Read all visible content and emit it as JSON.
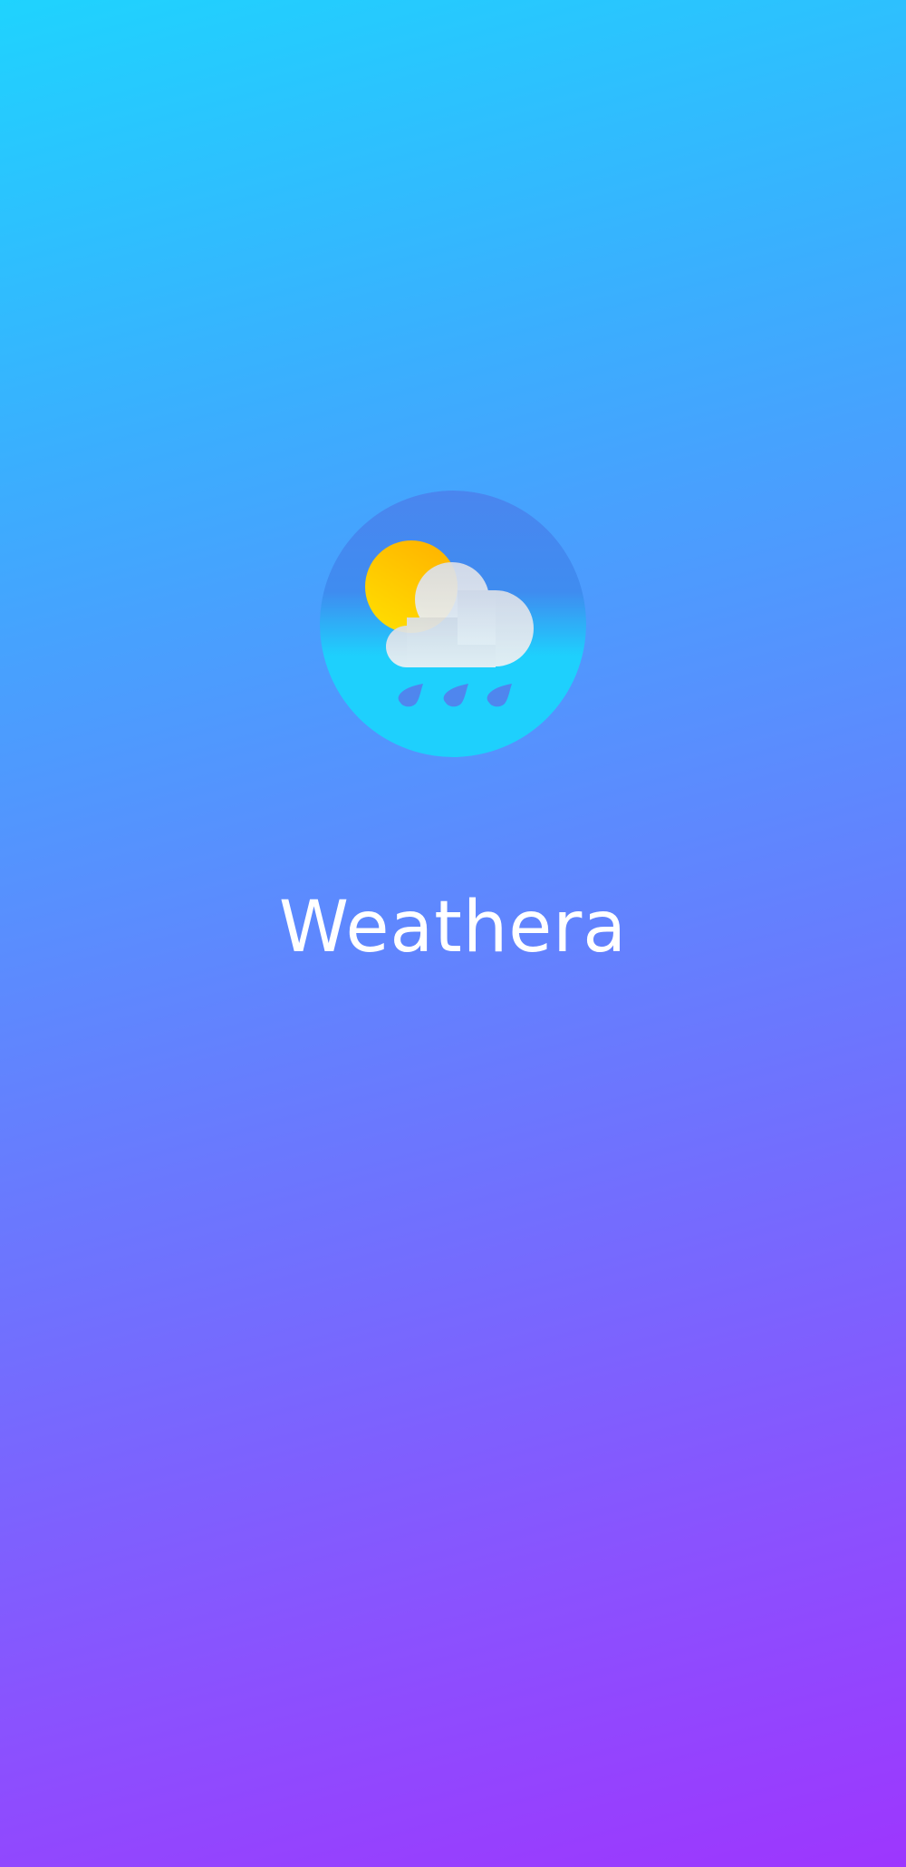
{
  "app": {
    "name": "Weathera"
  },
  "logo": {
    "icon": "partly-cloudy-rain-icon"
  },
  "colors": {
    "background_top": "#1fd3fe",
    "background_bottom": "#9d36fe",
    "logo_top": "#4a86ef",
    "logo_bottom": "#1ed0fd",
    "sun": "#ffc400",
    "cloud": "#e8ecf2",
    "raindrop": "#4f86ee",
    "text": "#ffffff"
  }
}
